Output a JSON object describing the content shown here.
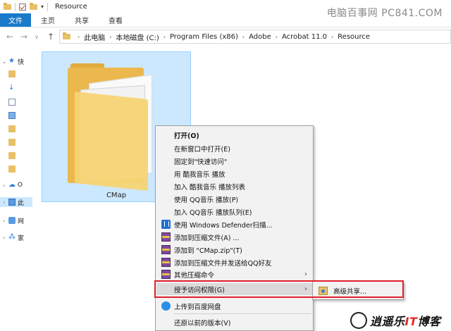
{
  "window": {
    "title": "Resource"
  },
  "ribbon": {
    "tabs": [
      "文件",
      "主页",
      "共享",
      "查看"
    ]
  },
  "watermark_top": "电脑百事网 PC841.COM",
  "address": {
    "crumbs": [
      "此电脑",
      "本地磁盘 (C:)",
      "Program Files (x86)",
      "Adobe",
      "Acrobat 11.0",
      "Resource"
    ]
  },
  "navpane": {
    "items": [
      {
        "label": "快",
        "icon": "star-icon"
      },
      {
        "label": "",
        "icon": "folder-icon"
      },
      {
        "label": "",
        "icon": "download-icon"
      },
      {
        "label": "",
        "icon": "document-icon"
      },
      {
        "label": "",
        "icon": "picture-icon"
      },
      {
        "label": "",
        "icon": "folder-icon"
      },
      {
        "label": "",
        "icon": "folder-icon"
      },
      {
        "label": "",
        "icon": "folder-icon"
      },
      {
        "label": "",
        "icon": "folder-icon"
      },
      {
        "label": "O",
        "icon": "onedrive-icon"
      },
      {
        "label": "此",
        "icon": "this-pc-icon"
      },
      {
        "label": "网",
        "icon": "network-icon"
      },
      {
        "label": "家",
        "icon": "homegroup-icon"
      }
    ]
  },
  "files": [
    {
      "name": "CMap"
    }
  ],
  "context_menu": {
    "items": [
      {
        "label": "打开(O)",
        "bold": true
      },
      {
        "label": "在新窗口中打开(E)"
      },
      {
        "label": "固定到\"快速访问\""
      },
      {
        "label": "用 酷我音乐 播放"
      },
      {
        "label": "加入 酷我音乐 播放列表"
      },
      {
        "label": "使用 QQ音乐 播放(P)"
      },
      {
        "label": "加入 QQ音乐 播放队列(E)"
      },
      {
        "label": "使用 Windows Defender扫描...",
        "icon": "defender-icon"
      },
      {
        "label": "添加到压缩文件(A) ...",
        "icon": "winrar-icon"
      },
      {
        "label": "添加到 \"CMap.zip\"(T)",
        "icon": "winrar-icon"
      },
      {
        "label": "添加到压缩文件并发送给QQ好友",
        "icon": "winrar-icon"
      },
      {
        "label": "其他压缩命令",
        "icon": "winrar-icon",
        "submenu": true
      },
      {
        "label": "授予访问权限(G)",
        "submenu": true,
        "highlighted": true
      },
      {
        "label": "上传到百度网盘",
        "icon": "baidu-netdisk-icon"
      },
      {
        "label": "还原以前的版本(V)"
      }
    ],
    "submenu_arrow": "›"
  },
  "submenu": {
    "label": "高级共享..."
  },
  "watermark_bottom": {
    "prefix": "逍遥乐",
    "it": "IT",
    "suffix": "博客"
  },
  "colors": {
    "accent": "#1979ca",
    "selection": "#cce8ff",
    "highlight_border": "#e2202a"
  }
}
